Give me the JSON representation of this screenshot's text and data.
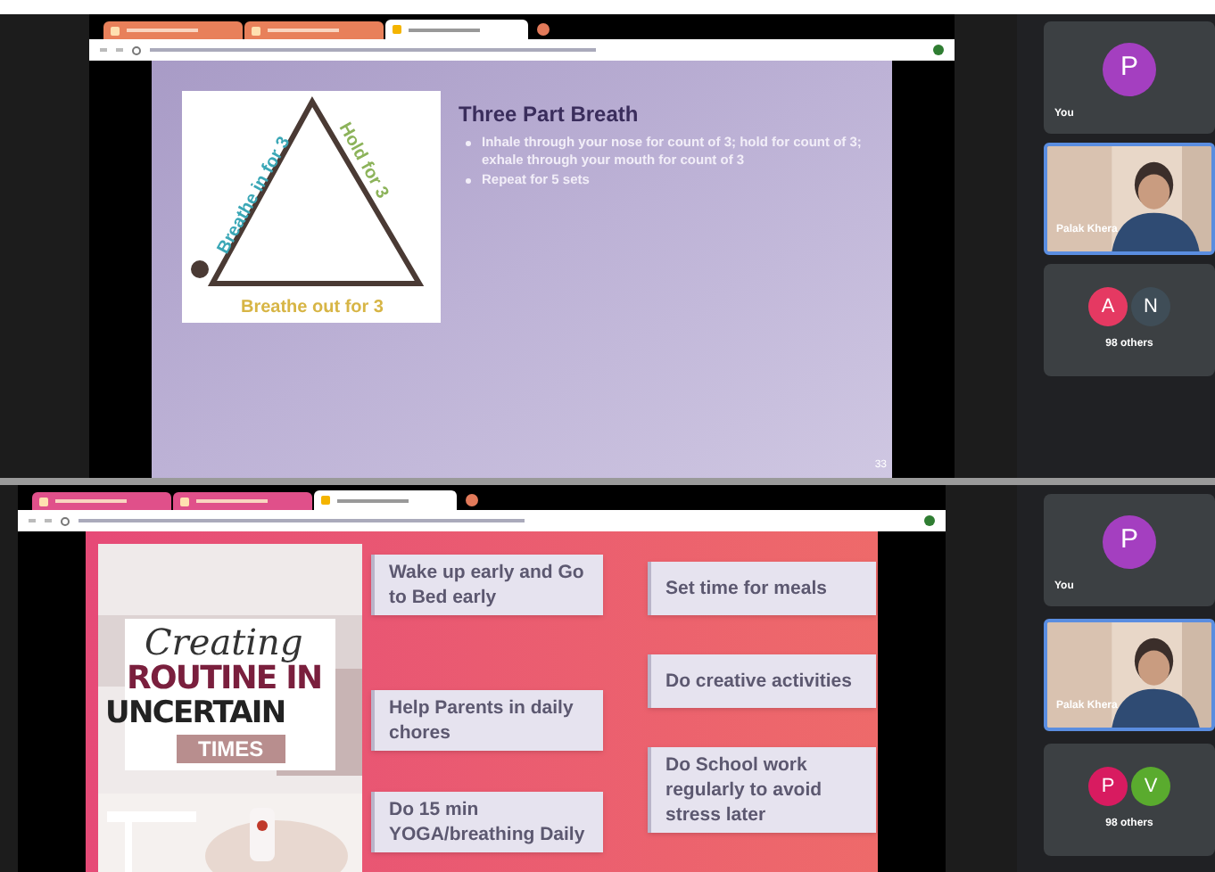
{
  "screens": [
    {
      "browser": {
        "tabs": [
          {
            "selected": false,
            "color": "#e8805a"
          },
          {
            "selected": false,
            "color": "#e8805a"
          },
          {
            "selected": true,
            "color": "#ffffff"
          }
        ]
      },
      "slide": {
        "kind": "breath",
        "title": "Three Part Breath",
        "bullets": [
          "Inhale through your nose for count of 3; hold for count of 3; exhale through your mouth for count of 3",
          "Repeat for 5 sets"
        ],
        "diagram": {
          "in_label": "Breathe in for 3",
          "hold_label": "Hold for 3",
          "out_label": "Breathe out for 3"
        },
        "page_number": "33"
      },
      "participants": [
        {
          "kind": "self",
          "label": "You",
          "avatars": [
            {
              "letter": "P",
              "color": "#a43fc0"
            }
          ]
        },
        {
          "kind": "video",
          "label": "Palak Khera"
        },
        {
          "kind": "others",
          "label": "98 others",
          "avatars": [
            {
              "letter": "A",
              "color": "#e53962"
            },
            {
              "letter": "N",
              "color": "#3f4d57"
            }
          ]
        }
      ]
    },
    {
      "browser": {
        "tabs": [
          {
            "selected": false,
            "color": "#e0508a"
          },
          {
            "selected": false,
            "color": "#e0508a"
          },
          {
            "selected": true,
            "color": "#ffffff"
          }
        ]
      },
      "slide": {
        "kind": "routine",
        "poster": {
          "script": "Creating",
          "line_1": "ROUTINE IN",
          "line_2": "UNCERTAIN",
          "badge": "TIMES"
        },
        "columns": [
          [
            "Wake up early and Go to Bed early",
            "Help Parents in daily chores",
            "Do 15 min YOGA/breathing Daily"
          ],
          [
            "Set time for meals",
            "Do creative activities",
            "Do School work regularly to avoid stress later"
          ]
        ]
      },
      "participants": [
        {
          "kind": "self",
          "label": "You",
          "avatars": [
            {
              "letter": "P",
              "color": "#a43fc0"
            }
          ]
        },
        {
          "kind": "video",
          "label": "Palak Khera"
        },
        {
          "kind": "others",
          "label": "98 others",
          "avatars": [
            {
              "letter": "P",
              "color": "#d81b60"
            },
            {
              "letter": "V",
              "color": "#5aab2e"
            }
          ]
        }
      ]
    }
  ]
}
